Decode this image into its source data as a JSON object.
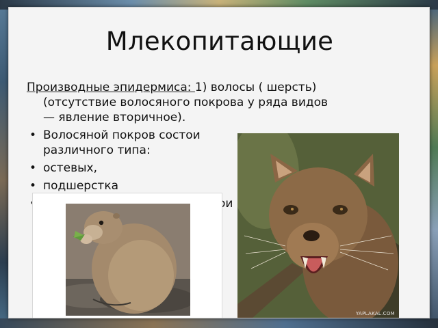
{
  "slide": {
    "title": "Млекопитающие",
    "intro_label": "Производные эпидермиса: ",
    "intro_rest": "1) волосы ( шерсть)",
    "intro_line2": "(отсутствие волосяного покрова у ряда видов",
    "intro_line3": "— явление вторичное).",
    "bullets": [
      {
        "line1": "Волосяной покров состои",
        "line2": "различного типа:"
      },
      {
        "line1": "остевых,",
        "line2": ""
      },
      {
        "line1": "подшерстка",
        "line2": ""
      },
      {
        "line1": "ои",
        "line2": ""
      }
    ],
    "bullet_symbol": "•"
  },
  "images": {
    "marmot": {
      "icon": "marmot-photo"
    },
    "fossa": {
      "icon": "fossa-photo",
      "watermark": "YAPLAKAL.COM"
    }
  }
}
